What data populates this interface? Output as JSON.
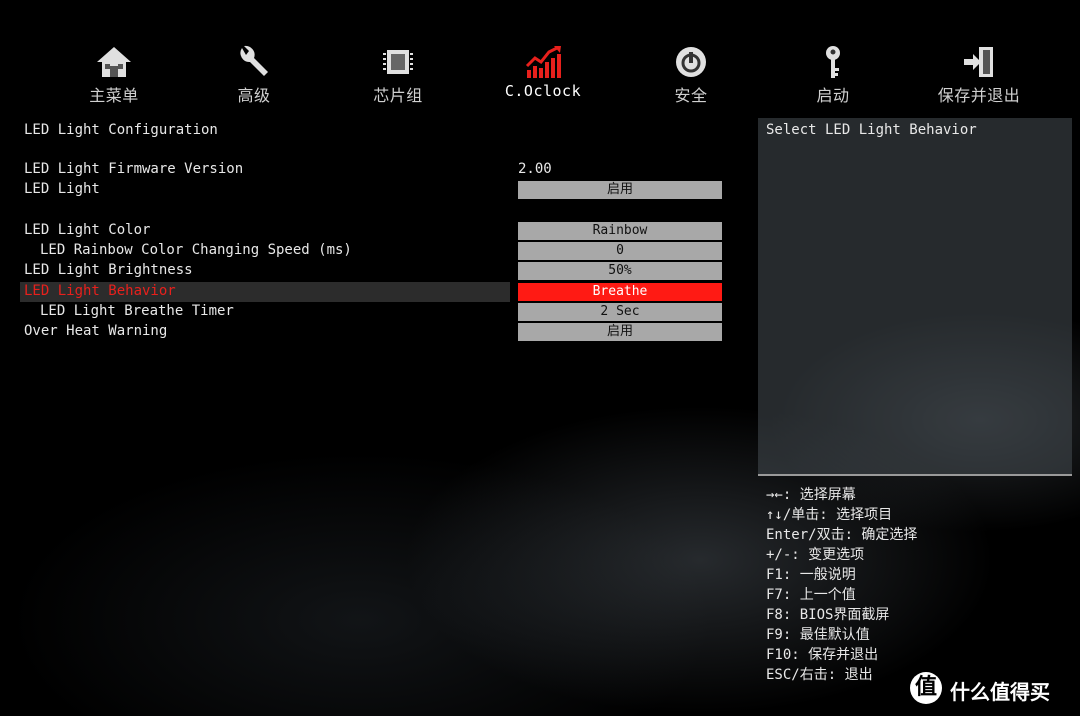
{
  "nav": {
    "items": [
      {
        "label": "主菜单",
        "icon": "home-icon"
      },
      {
        "label": "高级",
        "icon": "wrench-icon"
      },
      {
        "label": "芯片组",
        "icon": "chip-icon"
      },
      {
        "label": "C.Oclock",
        "icon": "overclock-chart-icon"
      },
      {
        "label": "安全",
        "icon": "power-shield-icon"
      },
      {
        "label": "启动",
        "icon": "key-icon"
      },
      {
        "label": "保存并退出",
        "icon": "exit-door-icon"
      }
    ],
    "active_index": 3
  },
  "main": {
    "section_title": "LED Light Configuration",
    "rows": [
      {
        "name": "LED Light Firmware Version",
        "value": "2.00",
        "type": "text"
      },
      {
        "name": "LED Light",
        "value": "启用",
        "type": "box"
      },
      {
        "name": "LED Light Color",
        "value": "Rainbow",
        "type": "box"
      },
      {
        "name": "LED Rainbow Color Changing Speed (ms)",
        "value": "0",
        "type": "box",
        "indent": true
      },
      {
        "name": "LED Light Brightness",
        "value": "50%",
        "type": "box"
      },
      {
        "name": "LED Light Behavior",
        "value": "Breathe",
        "type": "box",
        "selected": true
      },
      {
        "name": "LED Light Breathe Timer",
        "value": "2 Sec",
        "type": "box",
        "indent": true
      },
      {
        "name": "Over Heat Warning",
        "value": "启用",
        "type": "box"
      }
    ]
  },
  "help": {
    "description": "Select LED Light Behavior",
    "keys": [
      "→←: 选择屏幕",
      "↑↓/单击: 选择项目",
      "Enter/双击: 确定选择",
      "+/-: 变更选项",
      "F1: 一般说明",
      "F7: 上一个值",
      "F8: BIOS界面截屏",
      "F9: 最佳默认值",
      "F10: 保存并退出",
      "ESC/右击: 退出"
    ]
  },
  "watermark": {
    "logo": "值",
    "text": "什么值得买"
  },
  "colors": {
    "selected_text": "#e8201c",
    "selected_box": "#ff1a14",
    "value_box": "#a8a8a8",
    "active_icon": "#e8201c"
  }
}
